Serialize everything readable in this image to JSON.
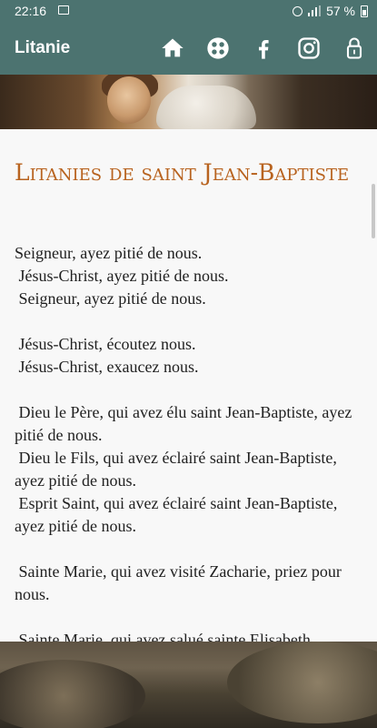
{
  "status_bar": {
    "time": "22:16",
    "battery": "57 %",
    "icons": [
      "image-icon",
      "alarm-icon",
      "signal-icon",
      "battery-icon"
    ]
  },
  "app_bar": {
    "title": "Litanie",
    "actions": [
      "home-icon",
      "apps-icon",
      "facebook-icon",
      "instagram-icon",
      "lock-icon"
    ]
  },
  "article": {
    "heading": "Litanies de saint Jean-Baptiste",
    "body": "Seigneur, ayez pitié de nous.\n Jésus-Christ, ayez pitié de nous.\n Seigneur, ayez pitié de nous.\n\n Jésus-Christ, écoutez nous.\n Jésus-Christ, exaucez nous.\n\n Dieu le Père, qui avez élu saint Jean-Baptiste, ayez pitié de nous.\n Dieu le Fils, qui avez éclairé saint Jean-Baptiste, ayez pitié de nous.\n Esprit Saint, qui avez éclairé saint Jean-Baptiste, ayez pitié de nous.\n\n Sainte Marie, qui avez visité Zacharie, priez pour nous.\n\n Sainte Marie, qui avez salué sainte Elisabeth"
  },
  "colors": {
    "primary": "#4c7370",
    "heading": "#b8631f"
  }
}
